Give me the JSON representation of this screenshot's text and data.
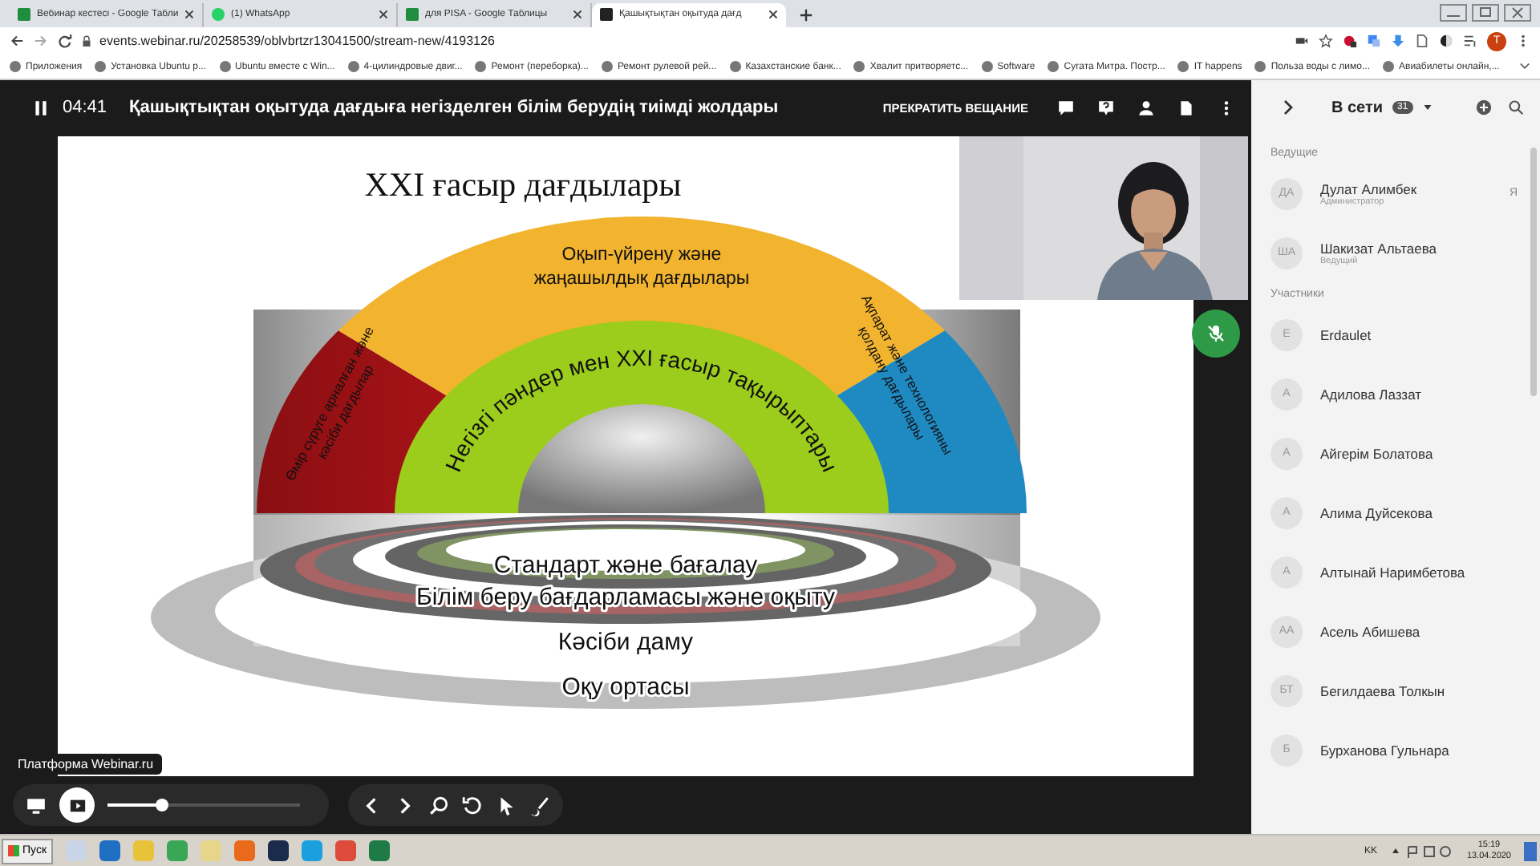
{
  "browser": {
    "tabs": [
      {
        "label": "Вебинар кестесі - Google Табли",
        "kind": "sheet",
        "selected": false
      },
      {
        "label": "(1) WhatsApp",
        "kind": "chat",
        "selected": false
      },
      {
        "label": "для PISA - Google Таблицы",
        "kind": "sheet",
        "selected": false
      },
      {
        "label": "Қашықтықтан оқытуда дағд",
        "kind": "web",
        "selected": true
      }
    ],
    "url": "events.webinar.ru/20258539/oblvbrtzr13041500/stream-new/4193126",
    "profile_initial": "T",
    "bookmarks": [
      "Приложения",
      "Установка Ubuntu р...",
      "Ubuntu вместе с Win...",
      "4-цилиндровые двиг...",
      "Ремонт (переборка)...",
      "Ремонт рулевой рей...",
      "Казахстанские банк...",
      "Хвалит притворяетс...",
      "Software",
      "Сугата Митра. Постр...",
      "IT happens",
      "Польза воды с лимо...",
      "Авиабилеты онлайн,..."
    ]
  },
  "webinar": {
    "timer": "04:41",
    "title": "Қашықтықтан оқытуда дағдыға негізделген білім берудің тиімді жолдары",
    "stop_button": "ПРЕКРАТИТЬ ВЕЩАНИЕ",
    "platform_label": "Платформа Webinar.ru",
    "zoom_slider": {
      "level": 0.28
    }
  },
  "slide": {
    "title": "XXI ғасыр дағдылары",
    "top_label": [
      "Оқып-үйрену және",
      "жаңашылдық дағдылары"
    ],
    "left_label": [
      "Өмір сүруге арналған және",
      "кәсіби дағдылар"
    ],
    "right_label": [
      "Ақпарат және технологияны",
      "қолдану дағдылары"
    ],
    "arc_label": "Негізгі пәндер мен XXI ғасыр тақырыптары",
    "ring_labels": [
      "Стандарт және бағалау",
      "Білім беру бағдарламасы және оқыту",
      "Кәсіби даму",
      "Оқу ортасы"
    ]
  },
  "sidebar": {
    "title": "В сети",
    "count": "31",
    "sections": [
      {
        "heading": "Ведущие",
        "people": [
          {
            "initials": "ДА",
            "name": "Дулат Алимбек",
            "role": "Администратор",
            "tag": "Я"
          },
          {
            "initials": "ША",
            "name": "Шакизат Альтаева",
            "role": "Ведущий"
          }
        ]
      },
      {
        "heading": "Участники",
        "people": [
          {
            "initials": "E",
            "name": "Erdaulet"
          },
          {
            "initials": "А",
            "name": "Адилова Лаззат"
          },
          {
            "initials": "А",
            "name": "Айгерім Болатова"
          },
          {
            "initials": "А",
            "name": "Алима Дуйсекова"
          },
          {
            "initials": "А",
            "name": "Алтынай Наримбетова"
          },
          {
            "initials": "АА",
            "name": "Асель Абишева"
          },
          {
            "initials": "БТ",
            "name": "Бегилдаева Толкын"
          },
          {
            "initials": "Б",
            "name": "Бурханова Гульнара"
          }
        ]
      }
    ]
  },
  "taskbar": {
    "start": "Пуск",
    "language": "KK",
    "time": "15:19",
    "date": "13.04.2020"
  }
}
